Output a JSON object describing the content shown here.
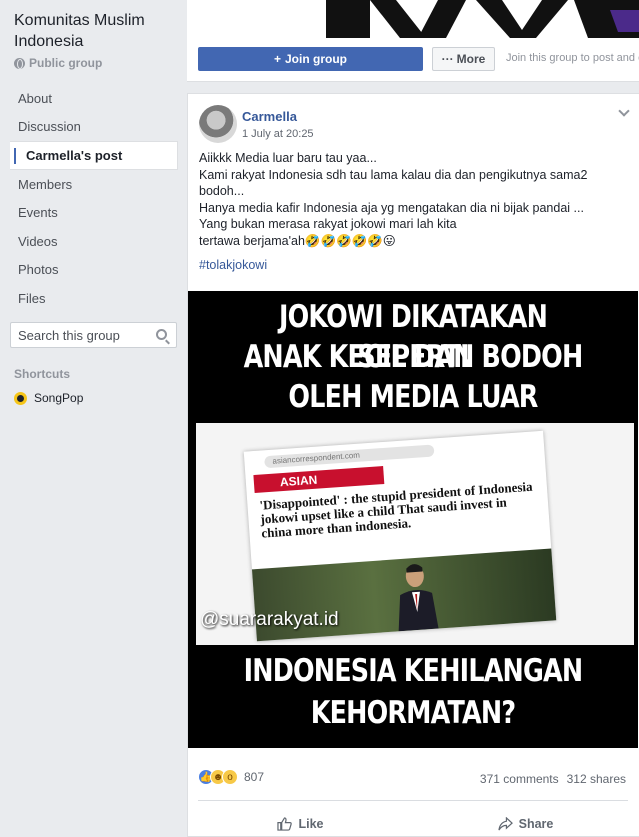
{
  "sidebar": {
    "group_name": "Komunitas Muslim Indonesia",
    "group_type": "Public group",
    "nav": [
      {
        "label": "About"
      },
      {
        "label": "Discussion"
      },
      {
        "label": "Carmella's post"
      },
      {
        "label": "Members"
      },
      {
        "label": "Events"
      },
      {
        "label": "Videos"
      },
      {
        "label": "Photos"
      },
      {
        "label": "Files"
      }
    ],
    "search_placeholder": "Search this group",
    "shortcuts_title": "Shortcuts",
    "shortcut_label": "SongPop"
  },
  "header": {
    "join_label": "Join group",
    "more_label": "More",
    "join_hint": "Join this group to post and c"
  },
  "post": {
    "author": "Carmella",
    "timestamp": "1 July at 20:25",
    "lines": [
      "Aiikkk Media luar baru tau yaa...",
      "Kami rakyat Indonesia sdh tau lama kalau dia dan pengikutnya sama2",
      "bodoh...",
      "Hanya media kafir Indonesia aja yg mengatakan dia ni bijak pandai ...",
      "Yang bukan merasa rakyat jokowi mari lah kita",
      "tertawa berjama'ah🤣🤣🤣🤣🤣😛"
    ],
    "hashtag": "#tolakjokowi",
    "image": {
      "headline_top": [
        "JOKOWI DIKATAKAN SEPERTI",
        "ANAK KECIL DAN BODOH",
        "OLEH MEDIA LUAR"
      ],
      "article_url": "asiancorrespondent.com",
      "article_brand": "ASIAN",
      "article_headline": "'Disappointed' : the stupid president of Indonesia jokowi upset like a child That saudi invest in china more than indonesia.",
      "watermark": "@suararakyat.id",
      "headline_bottom": [
        "INDONESIA KEHILANGAN",
        "KEHORMATAN?"
      ]
    },
    "reaction_count": "807",
    "comments": "371 comments",
    "shares": "312 shares",
    "like_label": "Like",
    "share_label": "Share"
  },
  "colors": {
    "brand_blue": "#4267b2",
    "link_blue": "#365899",
    "page_bg": "#e9ebee"
  }
}
